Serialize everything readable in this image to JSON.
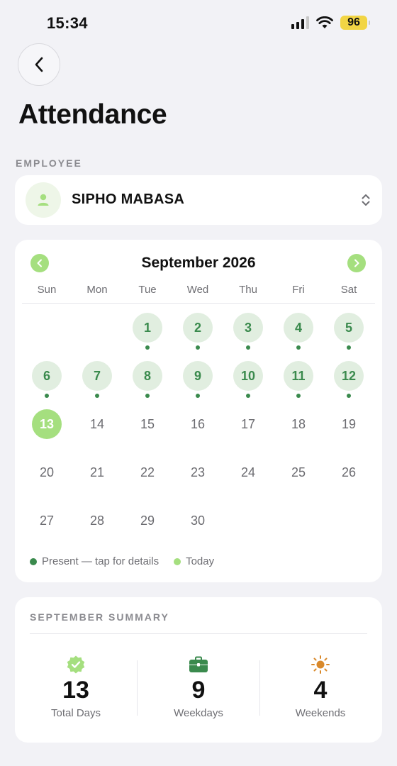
{
  "status_bar": {
    "time": "15:34",
    "battery": "96"
  },
  "header": {
    "title": "Attendance"
  },
  "employee": {
    "section_label": "EMPLOYEE",
    "name": "SIPHO MABASA"
  },
  "calendar": {
    "month_title": "September 2026",
    "weekdays": [
      "Sun",
      "Mon",
      "Tue",
      "Wed",
      "Thu",
      "Fri",
      "Sat"
    ],
    "first_weekday_index": 2,
    "days_in_month": 30,
    "present_days": [
      1,
      2,
      3,
      4,
      5,
      6,
      7,
      8,
      9,
      10,
      11,
      12
    ],
    "today": 13,
    "legend": {
      "present": "Present — tap for details",
      "today": "Today"
    }
  },
  "summary": {
    "title": "SEPTEMBER SUMMARY",
    "total": {
      "value": "13",
      "label": "Total Days",
      "icon": "verified-badge-icon"
    },
    "weekdays": {
      "value": "9",
      "label": "Weekdays",
      "icon": "briefcase-icon"
    },
    "weekends": {
      "value": "4",
      "label": "Weekends",
      "icon": "sun-icon"
    }
  },
  "colors": {
    "accent": "#a5df7f",
    "present": "#3a8a4d",
    "present_bg": "#e1eee0",
    "sun": "#d9892b"
  }
}
